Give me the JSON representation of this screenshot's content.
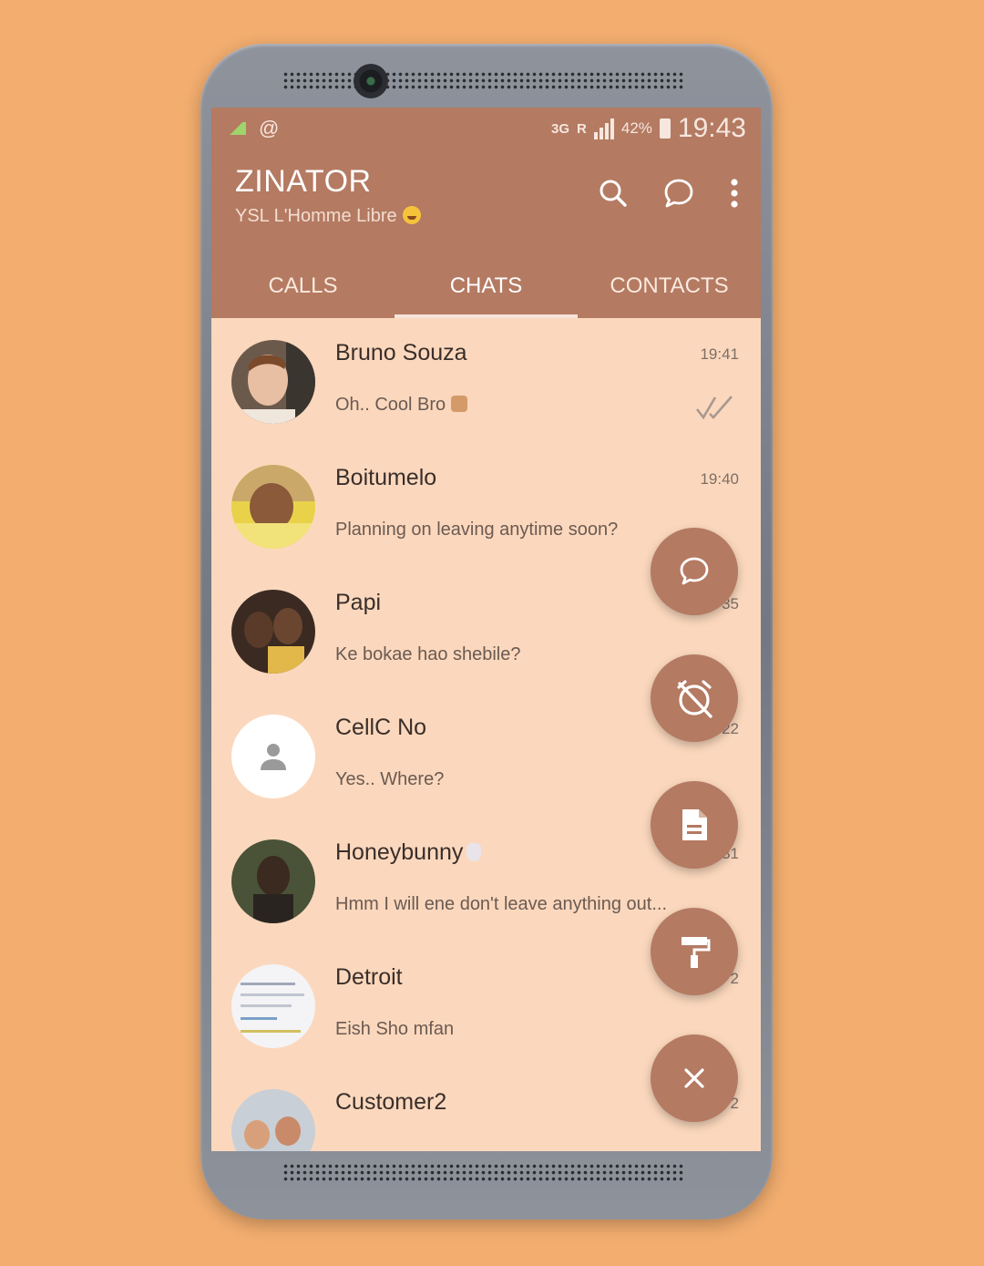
{
  "status_bar": {
    "email_icon": "@",
    "network_type": "3G",
    "roaming": "R",
    "battery_percent": "42%",
    "time": "19:43"
  },
  "app_bar": {
    "title": "ZINATOR",
    "subtitle": "YSL L'Homme Libre",
    "actions": [
      "search-icon",
      "new-chat-icon",
      "more-vert-icon"
    ]
  },
  "tabs": [
    {
      "label": "CALLS",
      "active": false
    },
    {
      "label": "CHATS",
      "active": true
    },
    {
      "label": "CONTACTS",
      "active": false
    }
  ],
  "chats": [
    {
      "name": "Bruno Souza",
      "time": "19:41",
      "message": "Oh.. Cool Bro",
      "emoji": "thumbs-up"
    },
    {
      "name": "Boitumelo",
      "time": "19:40",
      "message": "Planning on leaving anytime soon?"
    },
    {
      "name": "Papi",
      "time": "35",
      "message": "Ke bokae hao shebile?"
    },
    {
      "name": "CellC No",
      "time": "22",
      "message": "Yes.. Where?"
    },
    {
      "name": "Honeybunny",
      "time": "31",
      "message": "Hmm I will ene don't leave anything out..."
    },
    {
      "name": "Detroit",
      "time": "2",
      "message": "Eish Sho mfan"
    },
    {
      "name": "Customer2",
      "time": "2",
      "message": ""
    }
  ],
  "fab_menu": [
    "chat-bubble-icon",
    "alarm-off-icon",
    "document-icon",
    "paint-roller-icon",
    "close-icon"
  ],
  "colors": {
    "background": "#f2ad6f",
    "primary": "#b47a62",
    "list_background": "#fbd8bd"
  }
}
